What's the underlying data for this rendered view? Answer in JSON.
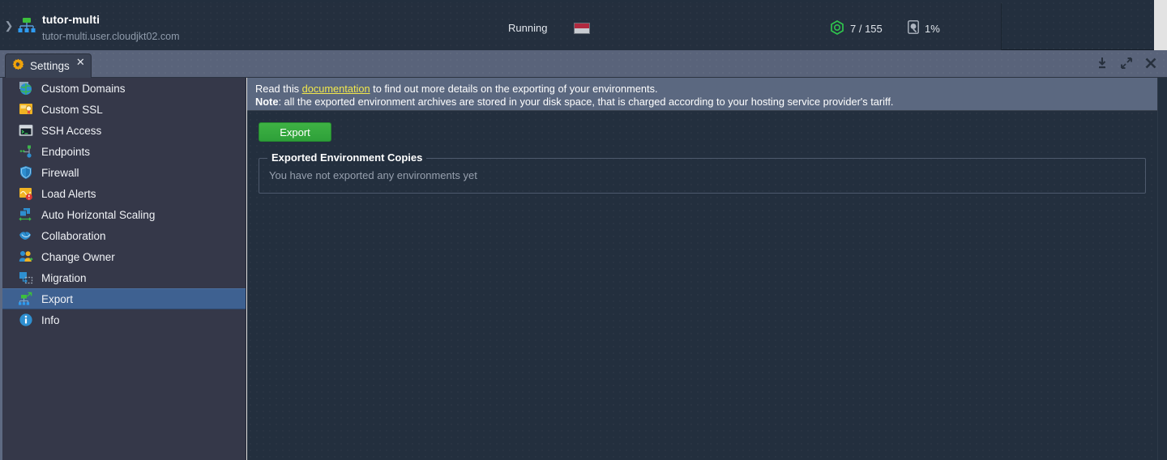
{
  "header": {
    "expander_icon": "chevron-right-icon",
    "env_icon": "environment-topology-icon",
    "title": "tutor-multi",
    "domain": "tutor-multi.user.cloudjkt02.com",
    "status": "Running",
    "region_flag": "indonesia-flag-icon",
    "flag_colors": {
      "top": "#b0293f",
      "bottom": "#c8ccd2"
    },
    "cloudlets_icon": "cloudlet-hexagon-icon",
    "cloudlets": "7 / 155",
    "disk_icon": "disk-drive-icon",
    "disk_usage": "1%"
  },
  "tabbar": {
    "tab_icon": "settings-gear-icon",
    "tab_label": "Settings",
    "close_icon": "close-icon",
    "controls": [
      {
        "name": "download-icon"
      },
      {
        "name": "expand-icon"
      },
      {
        "name": "close-icon"
      }
    ]
  },
  "sidebar": {
    "items": [
      {
        "label": "Custom Domains",
        "icon": "globe-icon",
        "selected": false
      },
      {
        "label": "Custom SSL",
        "icon": "certificate-icon",
        "selected": false
      },
      {
        "label": "SSH Access",
        "icon": "terminal-icon",
        "selected": false
      },
      {
        "label": "Endpoints",
        "icon": "endpoints-icon",
        "selected": false
      },
      {
        "label": "Firewall",
        "icon": "shield-icon",
        "selected": false
      },
      {
        "label": "Load Alerts",
        "icon": "load-alerts-icon",
        "selected": false
      },
      {
        "label": "Auto Horizontal Scaling",
        "icon": "horizontal-scaling-icon",
        "selected": false
      },
      {
        "label": "Collaboration",
        "icon": "handshake-icon",
        "selected": false
      },
      {
        "label": "Change Owner",
        "icon": "change-owner-icon",
        "selected": false
      },
      {
        "label": "Migration",
        "icon": "migration-icon",
        "selected": false
      },
      {
        "label": "Export",
        "icon": "export-icon",
        "selected": true
      },
      {
        "label": "Info",
        "icon": "info-icon",
        "selected": false
      }
    ]
  },
  "main": {
    "banner_line1_prefix": "Read this ",
    "banner_link": "documentation",
    "banner_line1_suffix": " to find out more details on the exporting of your environments.",
    "banner_note_label": "Note",
    "banner_line2": ": all the exported environment archives are stored in your disk space, that is charged according to your hosting service provider's tariff.",
    "export_button": "Export",
    "fieldset_legend": "Exported Environment Copies",
    "fieldset_empty_text": "You have not exported any environments yet"
  },
  "colors": {
    "header_bg": "#232f3e",
    "tabbar_bg": "#59637a",
    "sidebar_bg": "#353849",
    "selected_item": "#3e6191",
    "banner_bg": "#5b6880",
    "link_yellow": "#f2e84b",
    "export_green": "#2ea039"
  }
}
